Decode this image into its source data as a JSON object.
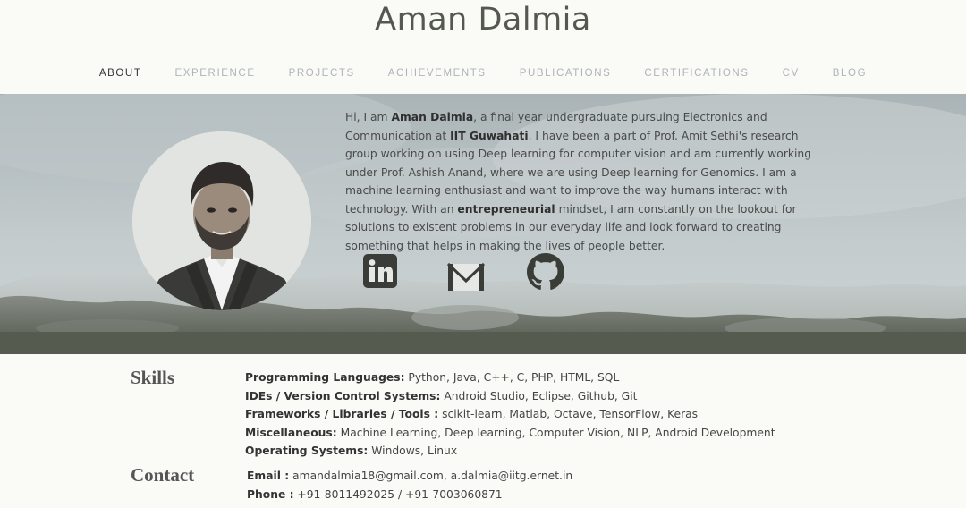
{
  "site": {
    "title": "Aman Dalmia"
  },
  "nav": {
    "items": [
      {
        "label": "ABOUT"
      },
      {
        "label": "EXPERIENCE"
      },
      {
        "label": "PROJECTS"
      },
      {
        "label": "ACHIEVEMENTS"
      },
      {
        "label": "PUBLICATIONS"
      },
      {
        "label": "CERTIFICATIONS"
      },
      {
        "label": "CV"
      },
      {
        "label": "BLOG"
      }
    ],
    "active": "ABOUT"
  },
  "bio": {
    "p1": "Hi, I am ",
    "name": "Aman Dalmia",
    "p2": ", a final year undergraduate pursuing Electronics and Communication at ",
    "inst": "IIT Guwahati",
    "p3": ". I have been a part of Prof. Amit Sethi's research group working on using Deep learning for computer vision and am currently working under Prof. Ashish Anand, where we are using Deep learning for Genomics. I am a machine learning enthusiast and want to improve the way humans interact with technology.  With an ",
    "mindset": "entrepreneurial",
    "p4": " mindset, I am constantly on the lookout for solutions to existent problems in our everyday life and look forward to creating something that helps in making the lives of people better."
  },
  "social": {
    "icons": [
      "linkedin-icon",
      "mail-icon",
      "github-icon"
    ]
  },
  "skills": {
    "heading": "Skills",
    "rows": [
      {
        "label": "Programming Languages:",
        "value": " Python, Java, C++, C, PHP, HTML, SQL"
      },
      {
        "label": "IDEs / Version Control Systems:",
        "value": " Android Studio, Eclipse, Github, Git"
      },
      {
        "label": "Frameworks / Libraries / Tools :",
        "value": " scikit-learn, Matlab, Octave, TensorFlow, Keras"
      },
      {
        "label": "Miscellaneous:",
        "value": " Machine Learning, Deep learning, Computer Vision, NLP, Android Development"
      },
      {
        "label": "Operating Systems:",
        "value": " Windows, Linux"
      }
    ]
  },
  "contact": {
    "heading": "Contact",
    "rows": [
      {
        "label": "Email  :",
        "value": "  amandalmia18@gmail.com, a.dalmia@iitg.ernet.in"
      },
      {
        "label": "Phone :",
        "value": "  +91-8011492025 / +91-7003060871"
      }
    ]
  }
}
